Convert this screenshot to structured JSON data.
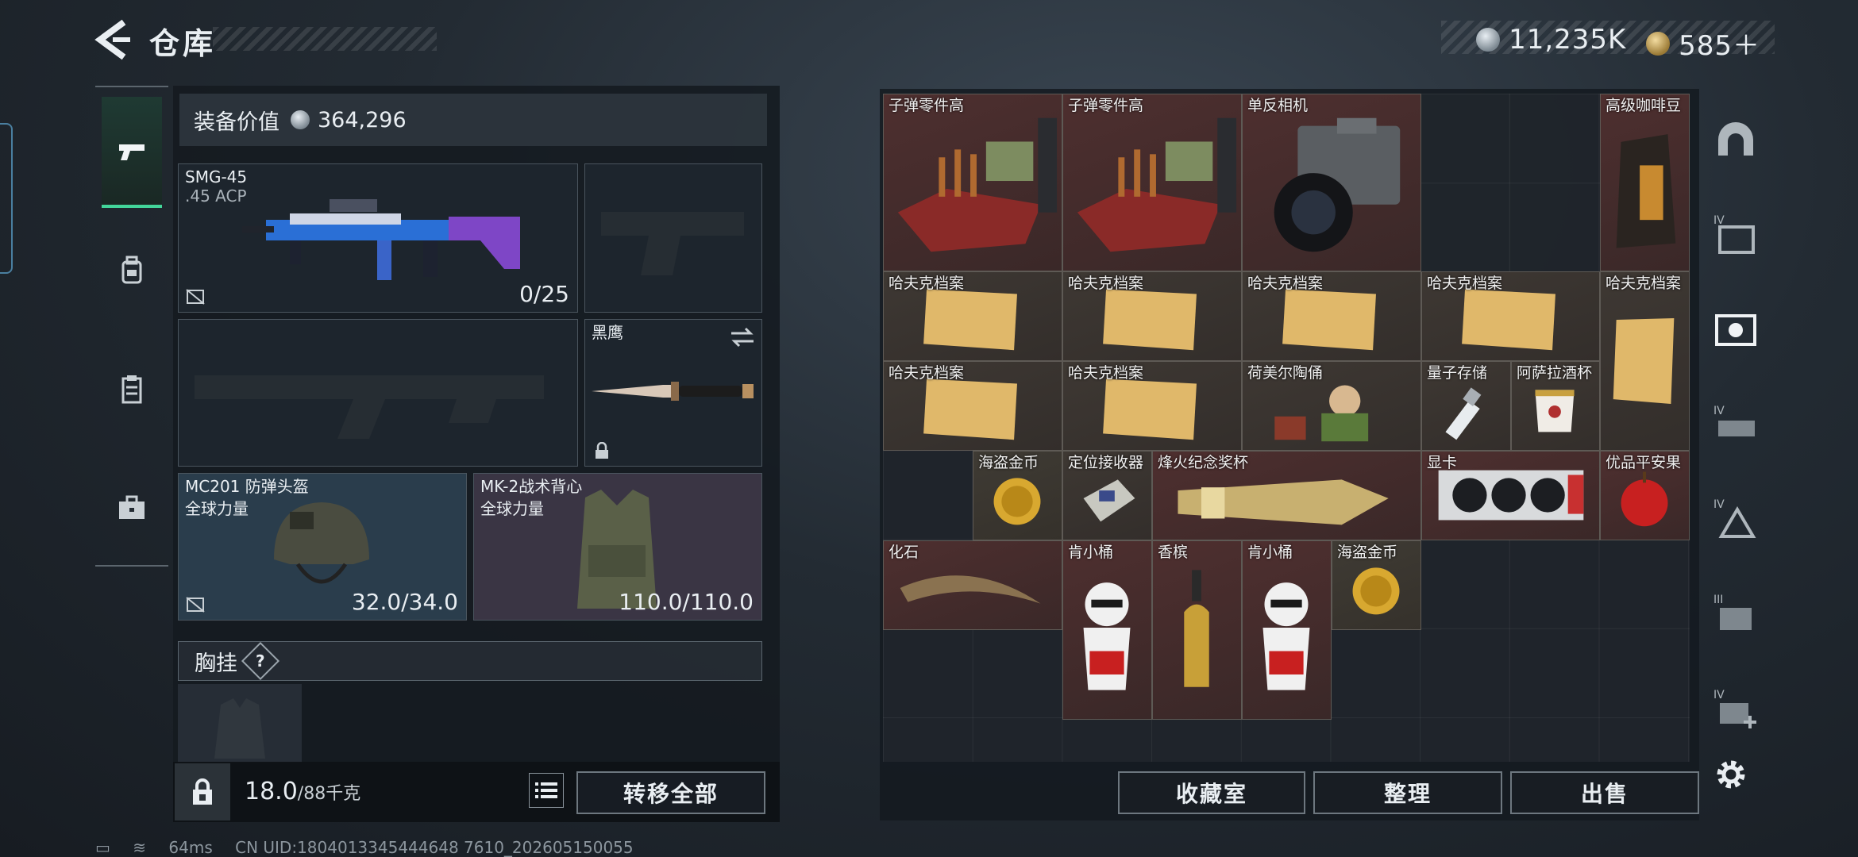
{
  "header": {
    "title": "仓库",
    "currency_silver": "11,235K",
    "currency_gold": "585＋"
  },
  "left_tabs": [
    {
      "name": "weapons",
      "icon": "pistol-icon",
      "active": true
    },
    {
      "name": "armor",
      "icon": "backpack-icon",
      "active": false
    },
    {
      "name": "rig",
      "icon": "clipboard-icon",
      "active": false
    },
    {
      "name": "case",
      "icon": "briefcase-icon",
      "active": false
    }
  ],
  "equipment": {
    "value_label": "装备价值",
    "value": "364,296",
    "primary": {
      "name": "SMG-45",
      "ammo": ".45 ACP",
      "count": "0/25"
    },
    "knife": {
      "name": "黑鹰"
    },
    "helmet": {
      "name": "MC201 防弹头盔",
      "brand": "全球力量",
      "durability": "32.0/34.0"
    },
    "vest": {
      "name": "MK-2战术背心",
      "brand": "全球力量",
      "durability": "110.0/110.0"
    },
    "chest_label": "胸挂",
    "chest_help": "?",
    "weight": "18.0",
    "weight_max": "/88千克",
    "transfer_all": "转移全部"
  },
  "storage": {
    "items": [
      {
        "label": "子弹零件高",
        "color": "red"
      },
      {
        "label": "子弹零件高",
        "color": "red"
      },
      {
        "label": "单反相机",
        "color": "red"
      },
      {
        "label": "高级咖啡豆",
        "color": "red"
      },
      {
        "label": "哈夫克档案",
        "color": "brown"
      },
      {
        "label": "哈夫克档案",
        "color": "brown"
      },
      {
        "label": "哈夫克档案",
        "color": "brown"
      },
      {
        "label": "哈夫克档案",
        "color": "brown"
      },
      {
        "label": "哈夫克档案",
        "color": "brown"
      },
      {
        "label": "哈夫克档案",
        "color": "brown"
      },
      {
        "label": "哈夫克档案",
        "color": "brown"
      },
      {
        "label": "荷美尔陶俑",
        "color": "brown"
      },
      {
        "label": "量子存储",
        "color": "brown"
      },
      {
        "label": "阿萨拉酒杯",
        "color": "brown"
      },
      {
        "label": "海盗金币",
        "color": "gold"
      },
      {
        "label": "定位接收器",
        "color": "brown"
      },
      {
        "label": "烽火纪念奖杯",
        "color": "red"
      },
      {
        "label": "显卡",
        "color": "red"
      },
      {
        "label": "优品平安果",
        "color": "red"
      },
      {
        "label": "化石",
        "color": "red"
      },
      {
        "label": "肯小桶",
        "color": "red"
      },
      {
        "label": "香槟",
        "color": "red"
      },
      {
        "label": "肯小桶",
        "color": "red"
      },
      {
        "label": "海盗金币",
        "color": "gold"
      }
    ],
    "buttons": {
      "collection": "收藏室",
      "sort": "整理",
      "sell": "出售"
    }
  },
  "right_tabs": [
    {
      "icon": "arch-icon"
    },
    {
      "icon": "folder-iv-icon",
      "tier": "IV"
    },
    {
      "icon": "camera-box-icon",
      "active": true
    },
    {
      "icon": "vehicle-iv-icon",
      "tier": "IV"
    },
    {
      "icon": "warning-iv-icon",
      "tier": "IV"
    },
    {
      "icon": "box-iii-icon",
      "tier": "III"
    },
    {
      "icon": "medkit-iv-icon",
      "tier": "IV"
    }
  ],
  "status": {
    "ping": "64ms",
    "uid": "CN UID:1804013345444648 7610_202605150055"
  }
}
